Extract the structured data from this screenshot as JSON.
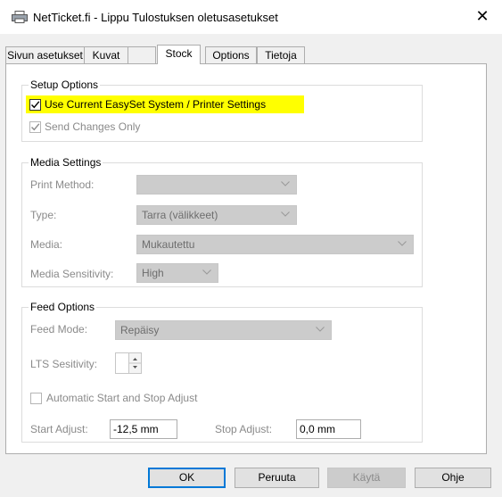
{
  "window": {
    "title": "NetTicket.fi - Lippu Tulostuksen oletusasetukset",
    "close_glyph": "✕"
  },
  "tabs": [
    {
      "label": "Sivun asetukset"
    },
    {
      "label": "Kuvat"
    },
    {
      "label": "Stock",
      "active": true
    },
    {
      "label": "Options"
    },
    {
      "label": "Tietoja"
    }
  ],
  "setup_options": {
    "group_label": "Setup Options",
    "use_current": {
      "label": "Use Current EasySet System / Printer Settings",
      "checked": true
    },
    "send_changes": {
      "label": "Send Changes Only",
      "checked": true,
      "disabled": true
    }
  },
  "media_settings": {
    "group_label": "Media Settings",
    "print_method": {
      "label": "Print Method:",
      "value": ""
    },
    "type": {
      "label": "Type:",
      "value": "Tarra (välikkeet)"
    },
    "media": {
      "label": "Media:",
      "value": "Mukautettu"
    },
    "sensitivity": {
      "label": "Media Sensitivity:",
      "value": "High"
    }
  },
  "feed_options": {
    "group_label": "Feed Options",
    "feed_mode": {
      "label": "Feed Mode:",
      "value": "Repäisy"
    },
    "lts": {
      "label": "LTS Sesitivity:",
      "value": ""
    },
    "auto_adjust": {
      "label": "Automatic Start and Stop Adjust",
      "checked": false
    },
    "start_adjust": {
      "label": "Start Adjust:",
      "value": "-12,5 mm"
    },
    "stop_adjust": {
      "label": "Stop Adjust:",
      "value": "0,0 mm"
    }
  },
  "buttons": {
    "ok": "OK",
    "cancel": "Peruuta",
    "apply": "Käytä",
    "help": "Ohje"
  },
  "colors": {
    "highlight": "#ffff00",
    "default_button_border": "#0078d7"
  },
  "icons": {
    "title": "printer-icon",
    "close": "close-icon",
    "dropdown": "chevron-down-icon",
    "check": "checkmark-icon",
    "spin": "spin-arrows-icon"
  }
}
